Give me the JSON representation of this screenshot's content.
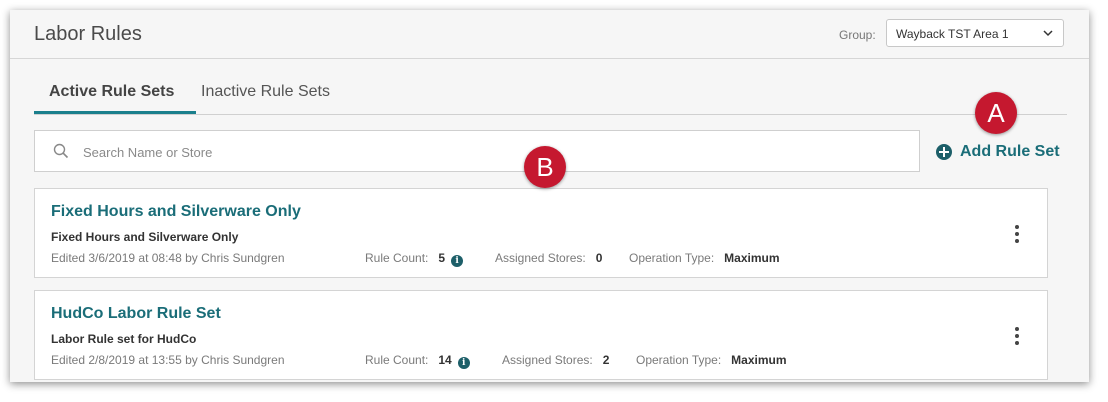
{
  "header": {
    "title": "Labor Rules",
    "group_label": "Group:",
    "group_value": "Wayback TST Area 1"
  },
  "tabs": [
    {
      "label": "Active Rule Sets",
      "active": true
    },
    {
      "label": "Inactive Rule Sets",
      "active": false
    }
  ],
  "search": {
    "placeholder": "Search Name or Store",
    "value": ""
  },
  "add_button": {
    "label": "Add Rule Set"
  },
  "markers": {
    "a": "A",
    "b": "B"
  },
  "labels": {
    "rule_count": "Rule Count:",
    "assigned_stores": "Assigned Stores:",
    "operation_type": "Operation Type:"
  },
  "rule_sets": [
    {
      "name": "Fixed Hours and Silverware Only",
      "description": "Fixed Hours and Silverware Only",
      "edited": "Edited 3/6/2019 at 08:48 by Chris Sundgren",
      "rule_count": "5",
      "assigned_stores": "0",
      "operation_type": "Maximum"
    },
    {
      "name": "HudCo Labor Rule Set",
      "description": "Labor Rule set for HudCo",
      "edited": "Edited 2/8/2019 at 13:55 by Chris Sundgren",
      "rule_count": "14",
      "assigned_stores": "2",
      "operation_type": "Maximum"
    }
  ],
  "colors": {
    "accent": "#1a7f8c",
    "link": "#1a6d78",
    "marker": "#c5182f"
  }
}
